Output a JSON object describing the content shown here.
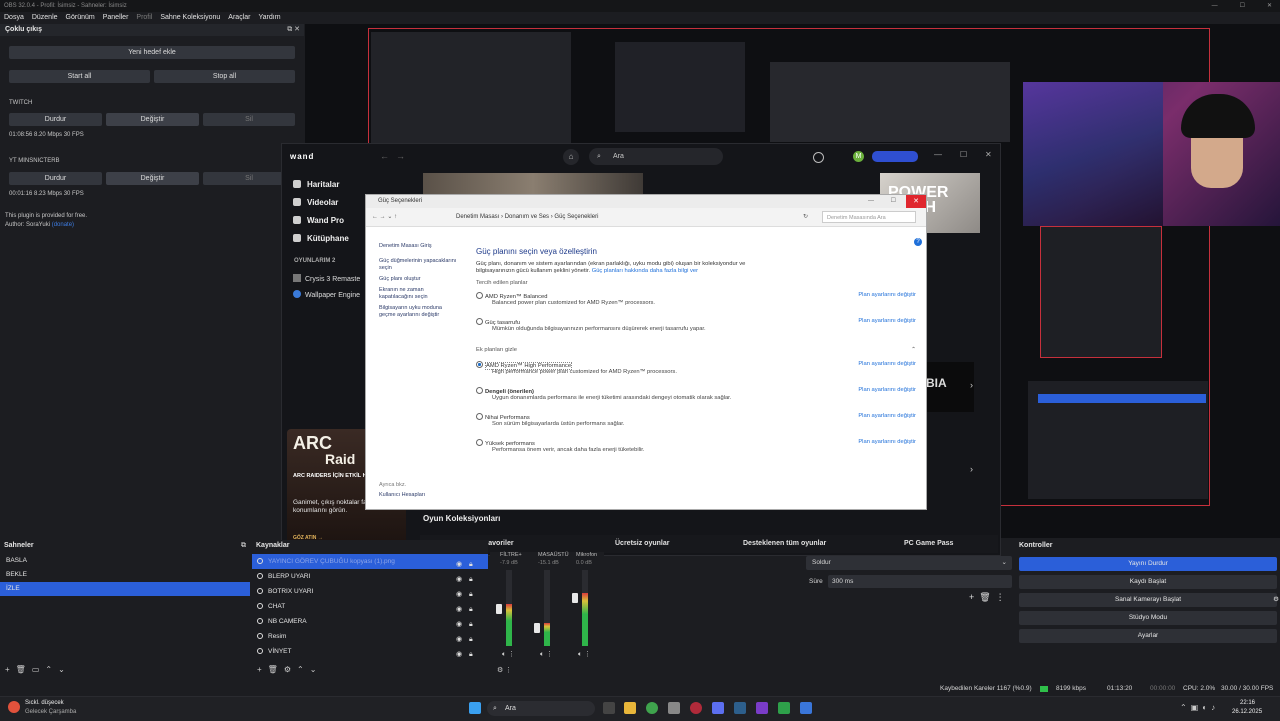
{
  "window": {
    "title": "OBS 32.0.4 - Profil: İsimsiz - Sahneler: İsimsiz",
    "controls": [
      "—",
      "☐",
      "✕"
    ]
  },
  "menu": [
    "Dosya",
    "Düzenle",
    "Görünüm",
    "Paneller",
    "Profil",
    "Sahne Koleksiyonu",
    "Araçlar",
    "Yardım"
  ],
  "multi_output": {
    "title": "Çoklu çıkış",
    "add_target": "Yeni hedef ekle",
    "start_all": "Start all",
    "stop_all": "Stop all",
    "targets": [
      {
        "name": "TWITCH",
        "stop": "Durdur",
        "edit": "Değiştir",
        "delete": "Sil",
        "stats": "01:08:56  8.20 Mbps  30 FPS"
      },
      {
        "name": "YT MINSNICTERB",
        "stop": "Durdur",
        "edit": "Değiştir",
        "delete": "Sil",
        "stats": "00:01:16  8.23 Mbps  30 FPS"
      }
    ],
    "free_note": "This plugin is provided for free.",
    "author": "Author: SoraYuki",
    "donate": "(donate)"
  },
  "wand": {
    "logo": "wand",
    "search_placeholder": "Ara",
    "nav": [
      "Haritalar",
      "Videolar",
      "Wand Pro",
      "Kütüphane"
    ],
    "games_header": "OYUNLARIM",
    "games_count": "2",
    "games": [
      "Crysis 3 Remaste",
      "Wallpaper Engine"
    ],
    "collections_title": "Oyun Koleksiyonları",
    "collection_tabs": [
      "Favoriler",
      "Ücretsiz oyunlar",
      "Desteklenen tüm oyunlar",
      "PC Game Pass"
    ],
    "promo": {
      "arc1": "ARC",
      "arc2": "Raid",
      "title": "ARC RAIDERS İÇİN ETKİL HARİTALAR",
      "body": "Ganimet, çıkış noktalar fazlasının tam konumlarını görün.",
      "cta": "GÖZ ATIN →"
    },
    "banner_text": "POWER WASH",
    "tile_text": "BIA"
  },
  "power": {
    "title": "Güç Seçenekleri",
    "breadcrumb": [
      "Denetim Masası",
      "Donanım ve Ses",
      "Güç Seçenekleri"
    ],
    "search_placeholder": "Denetim Masasında Ara",
    "sidebar": [
      "Denetim Masası Giriş",
      "Güç düğmelerinin yapacaklarını seçin",
      "Güç planı oluştur",
      "Ekranın ne zaman kapatılacağını seçin",
      "Bilgisayarın uyku moduna geçme ayarlarını değiştir"
    ],
    "see_also": "Ayrıca bkz.",
    "user_accounts": "Kullanıcı Hesapları",
    "heading": "Güç planını seçin veya özelleştirin",
    "intro": "Güç planı, donanım ve sistem ayarlarından (ekran parlaklığı, uyku modu gibi) oluşan bir koleksiyondur ve bilgisayarınızın gücü kullanım şeklini yönetir.",
    "intro_link": "Güç planları hakkında daha fazla bilgi ver",
    "preferred": "Tercih edilen planlar",
    "hide_more": "Ek planları gizle",
    "change": "Plan ayarlarını değiştir",
    "plans": [
      {
        "name": "AMD Ryzen™ Balanced",
        "desc": "Balanced power plan customized for AMD Ryzen™ processors.",
        "sel": false
      },
      {
        "name": "Güç tasarrufu",
        "desc": "Mümkün olduğunda bilgisayarınızın performansını düşürerek enerji tasarrufu yapar.",
        "sel": false
      },
      {
        "name": "AMD Ryzen™ High Performance",
        "desc": "High performance power plan customized for AMD Ryzen™ processors.",
        "sel": true
      },
      {
        "name": "Dengeli (önerilen)",
        "desc": "Uygun donanımlarda performans ile enerji tüketimi arasındaki dengeyi otomatik olarak sağlar.",
        "sel": false
      },
      {
        "name": "Nihai Performans",
        "desc": "Son sürüm bilgisayarlarda üstün performans sağlar.",
        "sel": false
      },
      {
        "name": "Yüksek performans",
        "desc": "Performansa önem verir, ancak daha fazla enerji tüketebilir.",
        "sel": false
      }
    ]
  },
  "scenes": {
    "title": "Sahneler",
    "items": [
      "BASLA",
      "BEKLE",
      "İZLE"
    ],
    "selected": 2
  },
  "sources": {
    "title": "Kaynaklar",
    "items": [
      "YAYINCI GÖREV ÇUBUĞU kopyası (1).png",
      "BLERP UYARI",
      "BOTRIX UYARI",
      "CHAT",
      "NB CAMERA",
      "Resim",
      "VİNYET"
    ],
    "selected": 0
  },
  "mixer": {
    "channels": [
      {
        "name": "FİLTRE+",
        "db": "-7.9 dB",
        "level": 0.55
      },
      {
        "name": "MASAÜSTÜ",
        "db": "-15.1 dB",
        "level": 0.3
      },
      {
        "name": "Mikrofon",
        "db": "0.0 dB",
        "level": 0.7
      }
    ]
  },
  "transitions": {
    "type": "Soldur",
    "duration_label": "Süre",
    "duration": "300 ms"
  },
  "controls": {
    "title": "Kontroller",
    "items": [
      "Yayını Durdur",
      "Kaydı Başlat",
      "Sanal Kamerayı Başlat",
      "Stüdyo Modu",
      "Ayarlar"
    ]
  },
  "status": {
    "dropped": "Kaybedilen Kareler 1167 (%0.9)",
    "kbps": "8199 kbps",
    "live": "01:13:20",
    "rec": "00:00:00",
    "cpu": "CPU: 2.0%",
    "fps": "30.00 / 30.00 FPS"
  },
  "taskbar": {
    "weather": "Sıckl. düşecek",
    "weather_sub": "Gelecek Çarşamba",
    "search": "Ara",
    "time": "22:16",
    "date": "26.12.2025"
  },
  "colors": {
    "accent": "#2b5fd9",
    "red": "#c6303c",
    "link": "#1e6fd9"
  }
}
